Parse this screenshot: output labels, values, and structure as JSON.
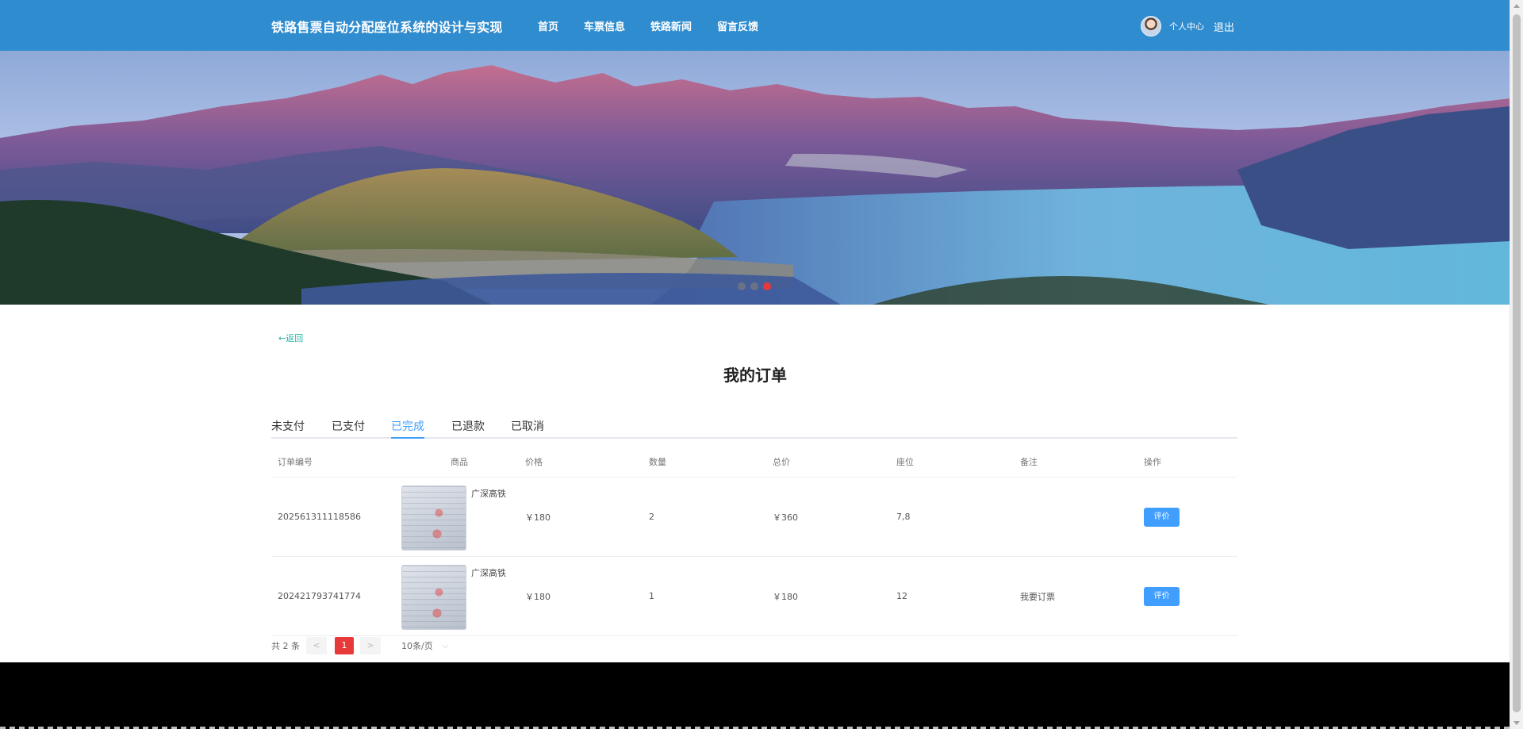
{
  "header": {
    "site_title": "铁路售票自动分配座位系统的设计与实现",
    "nav": [
      "首页",
      "车票信息",
      "铁路新闻",
      "留言反馈"
    ],
    "user_center": "个人中心",
    "logout": "退出",
    "bg_color": "#2f8ccf"
  },
  "banner": {
    "slides": 3,
    "active_slide": 3
  },
  "back_link": "←返回",
  "page_title": "我的订单",
  "tabs": [
    "未支付",
    "已支付",
    "已完成",
    "已退款",
    "已取消"
  ],
  "active_tab": "已完成",
  "table": {
    "headers": [
      "订单编号",
      "商品",
      "价格",
      "数量",
      "总价",
      "座位",
      "备注",
      "操作"
    ],
    "rows": [
      {
        "order_no": "202561311118586",
        "goods": "广深高铁",
        "price": "￥180",
        "qty": "2",
        "total": "￥360",
        "seat": "7,8",
        "note": "",
        "action": "评价"
      },
      {
        "order_no": "202421793741774",
        "goods": "广深高铁",
        "price": "￥180",
        "qty": "1",
        "total": "￥180",
        "seat": "12",
        "note": "我要订票",
        "action": "评价"
      }
    ]
  },
  "pagination": {
    "total_text": "共 2 条",
    "prev": "<",
    "current_page": "1",
    "next": ">",
    "page_size": "10条/页"
  },
  "colors": {
    "accent": "#409eff",
    "active_page": "#e8393a",
    "back_link": "#29b3a8"
  }
}
